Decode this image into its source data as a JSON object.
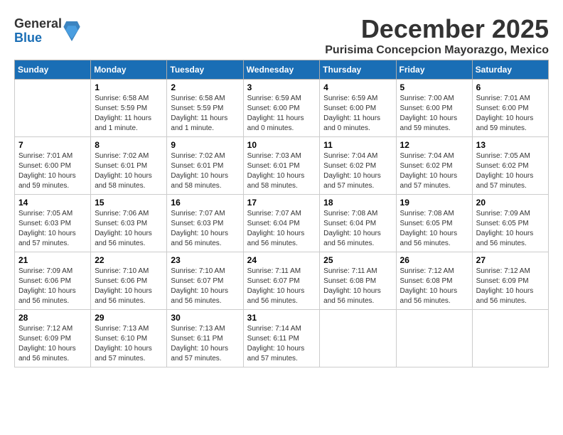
{
  "logo": {
    "general": "General",
    "blue": "Blue"
  },
  "header": {
    "month": "December 2025",
    "location": "Purisima Concepcion Mayorazgo, Mexico"
  },
  "days_of_week": [
    "Sunday",
    "Monday",
    "Tuesday",
    "Wednesday",
    "Thursday",
    "Friday",
    "Saturday"
  ],
  "weeks": [
    [
      {
        "day": "",
        "info": ""
      },
      {
        "day": "1",
        "info": "Sunrise: 6:58 AM\nSunset: 5:59 PM\nDaylight: 11 hours\nand 1 minute."
      },
      {
        "day": "2",
        "info": "Sunrise: 6:58 AM\nSunset: 5:59 PM\nDaylight: 11 hours\nand 1 minute."
      },
      {
        "day": "3",
        "info": "Sunrise: 6:59 AM\nSunset: 6:00 PM\nDaylight: 11 hours\nand 0 minutes."
      },
      {
        "day": "4",
        "info": "Sunrise: 6:59 AM\nSunset: 6:00 PM\nDaylight: 11 hours\nand 0 minutes."
      },
      {
        "day": "5",
        "info": "Sunrise: 7:00 AM\nSunset: 6:00 PM\nDaylight: 10 hours\nand 59 minutes."
      },
      {
        "day": "6",
        "info": "Sunrise: 7:01 AM\nSunset: 6:00 PM\nDaylight: 10 hours\nand 59 minutes."
      }
    ],
    [
      {
        "day": "7",
        "info": "Sunrise: 7:01 AM\nSunset: 6:00 PM\nDaylight: 10 hours\nand 59 minutes."
      },
      {
        "day": "8",
        "info": "Sunrise: 7:02 AM\nSunset: 6:01 PM\nDaylight: 10 hours\nand 58 minutes."
      },
      {
        "day": "9",
        "info": "Sunrise: 7:02 AM\nSunset: 6:01 PM\nDaylight: 10 hours\nand 58 minutes."
      },
      {
        "day": "10",
        "info": "Sunrise: 7:03 AM\nSunset: 6:01 PM\nDaylight: 10 hours\nand 58 minutes."
      },
      {
        "day": "11",
        "info": "Sunrise: 7:04 AM\nSunset: 6:02 PM\nDaylight: 10 hours\nand 57 minutes."
      },
      {
        "day": "12",
        "info": "Sunrise: 7:04 AM\nSunset: 6:02 PM\nDaylight: 10 hours\nand 57 minutes."
      },
      {
        "day": "13",
        "info": "Sunrise: 7:05 AM\nSunset: 6:02 PM\nDaylight: 10 hours\nand 57 minutes."
      }
    ],
    [
      {
        "day": "14",
        "info": "Sunrise: 7:05 AM\nSunset: 6:03 PM\nDaylight: 10 hours\nand 57 minutes."
      },
      {
        "day": "15",
        "info": "Sunrise: 7:06 AM\nSunset: 6:03 PM\nDaylight: 10 hours\nand 56 minutes."
      },
      {
        "day": "16",
        "info": "Sunrise: 7:07 AM\nSunset: 6:03 PM\nDaylight: 10 hours\nand 56 minutes."
      },
      {
        "day": "17",
        "info": "Sunrise: 7:07 AM\nSunset: 6:04 PM\nDaylight: 10 hours\nand 56 minutes."
      },
      {
        "day": "18",
        "info": "Sunrise: 7:08 AM\nSunset: 6:04 PM\nDaylight: 10 hours\nand 56 minutes."
      },
      {
        "day": "19",
        "info": "Sunrise: 7:08 AM\nSunset: 6:05 PM\nDaylight: 10 hours\nand 56 minutes."
      },
      {
        "day": "20",
        "info": "Sunrise: 7:09 AM\nSunset: 6:05 PM\nDaylight: 10 hours\nand 56 minutes."
      }
    ],
    [
      {
        "day": "21",
        "info": "Sunrise: 7:09 AM\nSunset: 6:06 PM\nDaylight: 10 hours\nand 56 minutes."
      },
      {
        "day": "22",
        "info": "Sunrise: 7:10 AM\nSunset: 6:06 PM\nDaylight: 10 hours\nand 56 minutes."
      },
      {
        "day": "23",
        "info": "Sunrise: 7:10 AM\nSunset: 6:07 PM\nDaylight: 10 hours\nand 56 minutes."
      },
      {
        "day": "24",
        "info": "Sunrise: 7:11 AM\nSunset: 6:07 PM\nDaylight: 10 hours\nand 56 minutes."
      },
      {
        "day": "25",
        "info": "Sunrise: 7:11 AM\nSunset: 6:08 PM\nDaylight: 10 hours\nand 56 minutes."
      },
      {
        "day": "26",
        "info": "Sunrise: 7:12 AM\nSunset: 6:08 PM\nDaylight: 10 hours\nand 56 minutes."
      },
      {
        "day": "27",
        "info": "Sunrise: 7:12 AM\nSunset: 6:09 PM\nDaylight: 10 hours\nand 56 minutes."
      }
    ],
    [
      {
        "day": "28",
        "info": "Sunrise: 7:12 AM\nSunset: 6:09 PM\nDaylight: 10 hours\nand 56 minutes."
      },
      {
        "day": "29",
        "info": "Sunrise: 7:13 AM\nSunset: 6:10 PM\nDaylight: 10 hours\nand 57 minutes."
      },
      {
        "day": "30",
        "info": "Sunrise: 7:13 AM\nSunset: 6:11 PM\nDaylight: 10 hours\nand 57 minutes."
      },
      {
        "day": "31",
        "info": "Sunrise: 7:14 AM\nSunset: 6:11 PM\nDaylight: 10 hours\nand 57 minutes."
      },
      {
        "day": "",
        "info": ""
      },
      {
        "day": "",
        "info": ""
      },
      {
        "day": "",
        "info": ""
      }
    ]
  ]
}
